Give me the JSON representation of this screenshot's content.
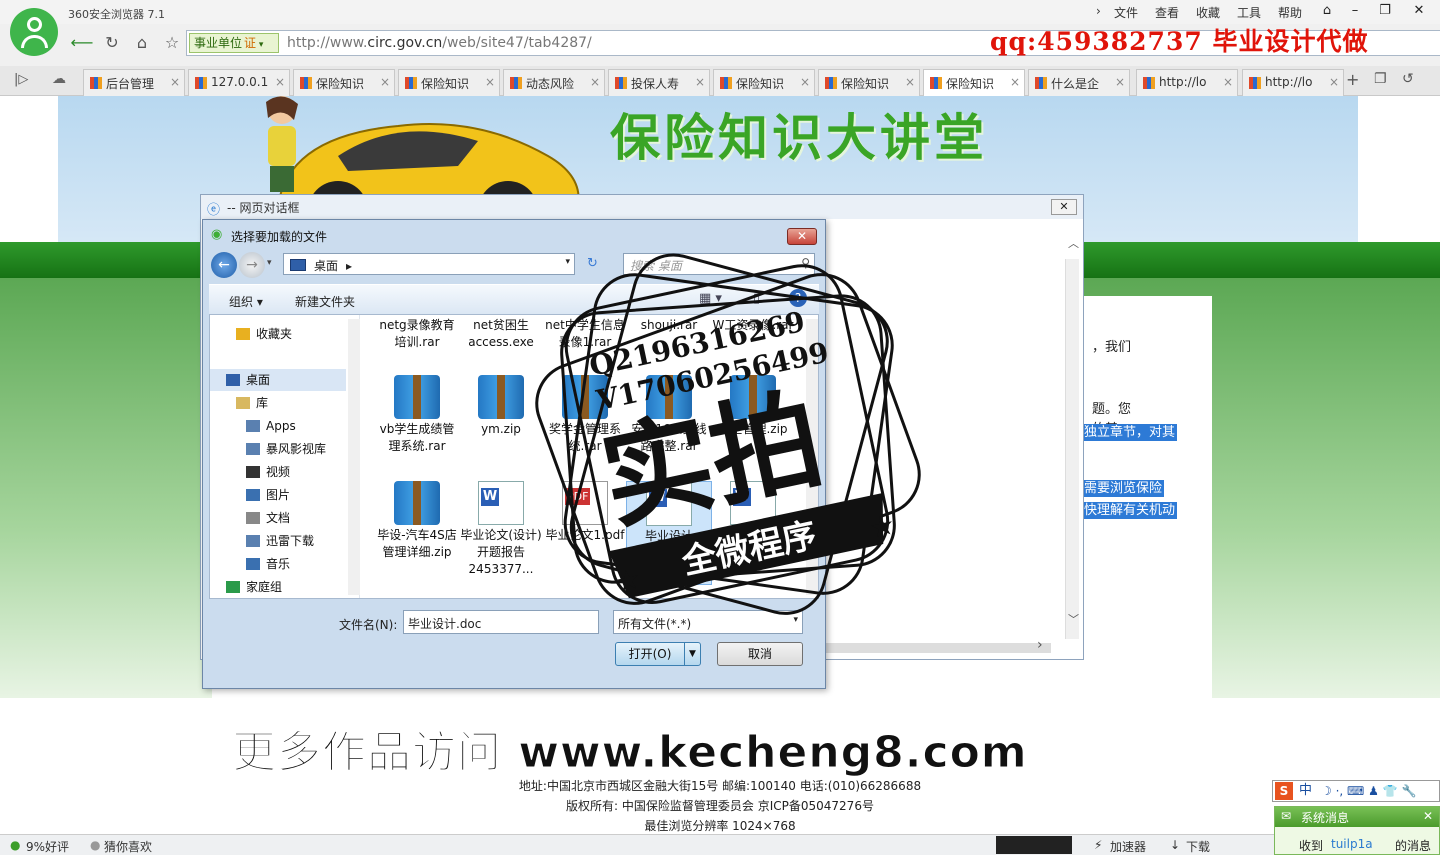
{
  "window": {
    "title": "360安全浏览器 7.1",
    "menu": [
      "文件",
      "查看",
      "收藏",
      "工具",
      "帮助"
    ]
  },
  "address": {
    "site_tag": "事业单位",
    "site_badge": "证",
    "url_prefix": "http://www.",
    "url_domain": "circ.gov.cn",
    "url_path": "/web/site47/tab4287/"
  },
  "overlay": {
    "qq": "qq:459382737  毕业设计代做"
  },
  "tabs": [
    {
      "label": "后台管理"
    },
    {
      "label": "127.0.0.1"
    },
    {
      "label": "保险知识"
    },
    {
      "label": "保险知识"
    },
    {
      "label": "动态风险"
    },
    {
      "label": "投保人寿"
    },
    {
      "label": "保险知识"
    },
    {
      "label": "保险知识"
    },
    {
      "label": "保险知识",
      "active": true
    },
    {
      "label": "什么是企"
    },
    {
      "label": "http://lo"
    },
    {
      "label": "http://lo"
    }
  ],
  "page": {
    "banner_title": "保险知识大讲堂",
    "text_snips": [
      "，我们",
      "题。您",
      "的基",
      "独立章节，对其",
      "需要浏览保险",
      "快理解有关机动"
    ],
    "footer": [
      "地址:中国北京市西城区金融大街15号 邮编:100140 电话:(010)66286688",
      "版权所有: 中国保险监督管理委员会 京ICP备05047276号",
      "最佳浏览分辨率 1024×768"
    ]
  },
  "web_dialog": {
    "title": "-- 网页对话框"
  },
  "file_dialog": {
    "title": "选择要加载的文件",
    "path": "桌面",
    "search_placeholder": "搜索 桌面",
    "toolbar": {
      "organize": "组织 ▾",
      "new_folder": "新建文件夹"
    },
    "nav": [
      {
        "label": "收藏夹",
        "icon": "star-icon"
      },
      {
        "label": "桌面",
        "icon": "desktop-icon"
      },
      {
        "label": "库",
        "icon": "library-icon"
      },
      {
        "label": "Apps",
        "icon": "folder-icon"
      },
      {
        "label": "暴风影视库",
        "icon": "folder-icon"
      },
      {
        "label": "视频",
        "icon": "video-icon"
      },
      {
        "label": "图片",
        "icon": "picture-icon"
      },
      {
        "label": "文档",
        "icon": "document-icon"
      },
      {
        "label": "迅雷下载",
        "icon": "folder-icon"
      },
      {
        "label": "音乐",
        "icon": "music-icon"
      },
      {
        "label": "家庭组",
        "icon": "homegroup-icon"
      }
    ],
    "files": [
      {
        "label": "netg录像教育培训.rar",
        "type": "none"
      },
      {
        "label": "net贫困生access.exe",
        "type": "none"
      },
      {
        "label": "net中学生信息录像1.rar",
        "type": "none"
      },
      {
        "label": "shouji.rar",
        "type": "none"
      },
      {
        "label": "W工资录像.rar",
        "type": "none"
      },
      {
        "label": "vb学生成绩管理系统.rar",
        "type": "rar"
      },
      {
        "label": "ym.zip",
        "type": "rar"
      },
      {
        "label": "奖学金管理系统.rar",
        "type": "rar"
      },
      {
        "label": "安全16公交线路完整.rar",
        "type": "rar"
      },
      {
        "label": "安全管理.zip",
        "type": "rar"
      },
      {
        "label": "毕设-汽车4S店管理详细.zip",
        "type": "rar"
      },
      {
        "label": "毕业论文(设计)开题报告2453377...",
        "type": "docx"
      },
      {
        "label": "毕业论文1.pdf",
        "type": "pdf"
      },
      {
        "label": "毕业设计",
        "type": "docx",
        "selected": true
      },
      {
        "label": "6380453 8.docx",
        "type": "docx"
      }
    ],
    "filename_label": "文件名(N):",
    "filename_value": "毕业设计.doc",
    "filetype": "所有文件(*.*)",
    "open_btn": "打开(O)",
    "cancel_btn": "取消"
  },
  "stamp": {
    "line1": "Q2196316269",
    "line2": "V17060256499",
    "big": "实拍",
    "ribbon": "全微程序"
  },
  "watermark": "更多作品访问 www.kecheng8.com",
  "statusbar": {
    "rating": "9%好评",
    "guess": "猜你喜欢",
    "accelerator": "加速器",
    "download": "下载"
  },
  "sysmsg": {
    "title": "系统消息",
    "recv": "收到",
    "user": "tuilp1a",
    "suffix": "的消息"
  },
  "ime": {
    "label": "中"
  }
}
